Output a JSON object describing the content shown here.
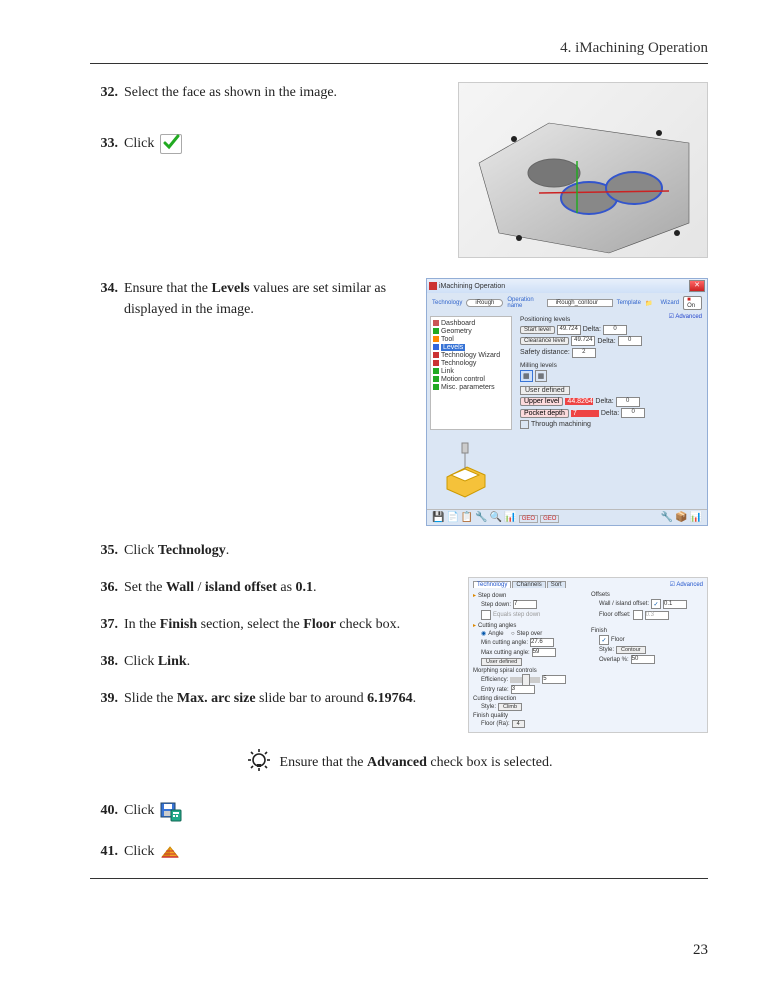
{
  "header": {
    "chapter": "4. iMachining Operation"
  },
  "steps": {
    "s32": {
      "num": "32.",
      "text_a": "Select the face as shown in the image."
    },
    "s33": {
      "num": "33.",
      "text_a": "Click "
    },
    "s34": {
      "num": "34.",
      "text_a": "Ensure that the ",
      "bold_a": "Levels",
      "text_b": " values are set similar as displayed in the image."
    },
    "s35": {
      "num": "35.",
      "text_a": "Click ",
      "bold_a": "Technology",
      "text_b": "."
    },
    "s36": {
      "num": "36.",
      "text_a": "Set the ",
      "bold_a": "Wall",
      "text_b": " / ",
      "bold_b": "island offset",
      "text_c": " as ",
      "bold_c": "0.1",
      "text_d": "."
    },
    "s37": {
      "num": "37.",
      "text_a": "In the ",
      "bold_a": "Finish",
      "text_b": " section, select the ",
      "bold_b": "Floor",
      "text_c": " check box."
    },
    "s38": {
      "num": "38.",
      "text_a": "Click ",
      "bold_a": "Link",
      "text_b": "."
    },
    "s39": {
      "num": "39.",
      "text_a": "Slide the ",
      "bold_a": "Max. arc size",
      "text_b": " slide bar to around ",
      "bold_b": "6.19764",
      "text_c": "."
    },
    "s40": {
      "num": "40.",
      "text_a": "Click "
    },
    "s41": {
      "num": "41.",
      "text_a": "Click "
    }
  },
  "tip": {
    "text_a": "Ensure that the ",
    "bold_a": "Advanced",
    "text_b": " check box is selected."
  },
  "page_number": "23",
  "dialog1": {
    "title": "iMachining Operation",
    "top": {
      "tech": "Technology",
      "tech_val": "iRough",
      "opname": "Operation name",
      "opname_val": "iRough_contour",
      "template": "Template",
      "wizard": "Wizard",
      "wiz_btn": "On",
      "advanced": "Advanced"
    },
    "tree": [
      "Dashboard",
      "Geometry",
      "Tool",
      "Levels",
      "Technology Wizard",
      "Technology",
      "Link",
      "Motion control",
      "Misc. parameters"
    ],
    "pos_levels": "Positioning levels",
    "start_level": "Start level",
    "start_val": "49.724",
    "delta1": "Delta:",
    "d1v": "0",
    "clearance": "Clearance level",
    "clr_val": "49.724",
    "delta2": "Delta:",
    "d2v": "0",
    "safety": "Safety distance:",
    "safety_val": "2",
    "mill_levels": "Milling levels",
    "user_def": "User defined",
    "upper": "Upper level",
    "upper_val": "44.8264",
    "delta3": "Delta:",
    "d3v": "0",
    "pocket": "Pocket depth",
    "pocket_val": "7",
    "delta4": "Delta:",
    "d4v": "0",
    "through": "Through machining"
  },
  "dialog2": {
    "tabs": [
      "Technology",
      "Channels",
      "Sort"
    ],
    "advanced": "Advanced",
    "step_down": "Step down",
    "step_down_l": "Step down:",
    "step_down_v": "7",
    "equal_sd": "Equals step down",
    "offsets": "Offsets",
    "wall_off": "Wall / island offset:",
    "wall_v": "0.1",
    "floor_off": "Floor offset:",
    "floor_v": "0.3",
    "cut_ang": "Cutting angles",
    "angle": "Angle",
    "step_over": "Step over",
    "min_ca": "Min cutting angle:",
    "min_v": "27.6",
    "max_ca": "Max cutting angle:",
    "max_v": "59",
    "ud": "User defined",
    "finish": "Finish",
    "floor": "Floor",
    "style": "Style:",
    "style_v": "Contour",
    "overlap": "Overlap %:",
    "overlap_v": "50",
    "morph": "Morphing spiral controls",
    "eff": "Efficiency:",
    "eff_v": "5",
    "entry": "Entry rate:",
    "entry_v": "3",
    "cdir": "Cutting direction",
    "cdir_s": "Style:",
    "cdir_v": "Climb",
    "fq": "Finish quality",
    "floorra": "Floor (Ra):",
    "fra_v": "4"
  }
}
